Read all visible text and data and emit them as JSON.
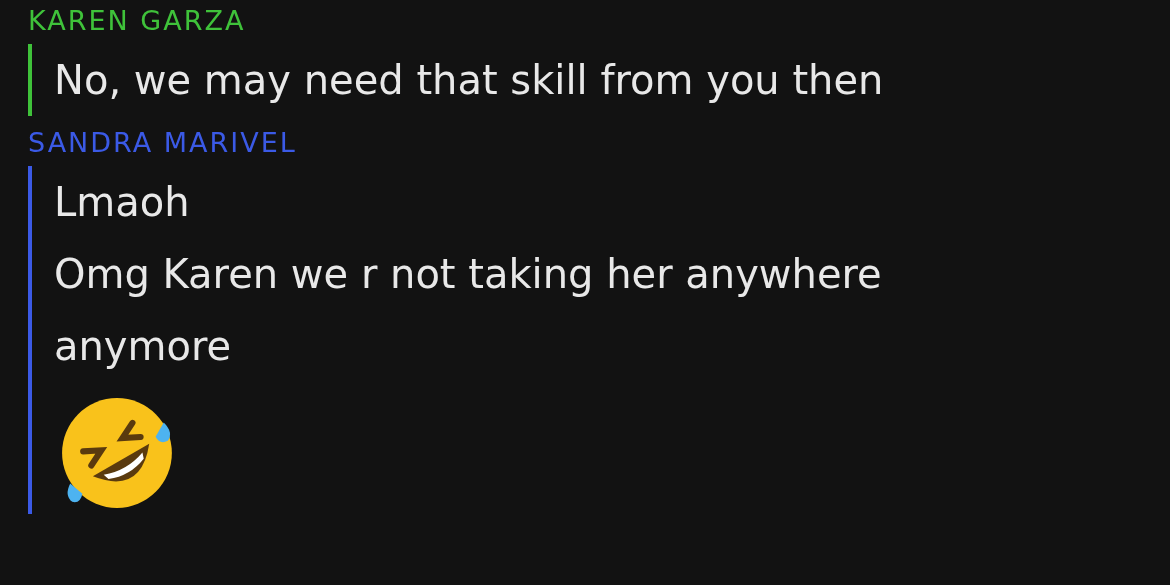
{
  "messages": [
    {
      "sender": "KAREN GARZA",
      "color": "#3fc23a",
      "items": [
        {
          "kind": "text",
          "text": "No, we may need that skill from you then"
        }
      ]
    },
    {
      "sender": "SANDRA MARIVEL",
      "color": "#3b5ae6",
      "items": [
        {
          "kind": "text",
          "text": "Lmaoh"
        },
        {
          "kind": "text",
          "text": "Omg Karen we r not taking her anywhere anymore"
        },
        {
          "kind": "emoji"
        }
      ]
    }
  ]
}
